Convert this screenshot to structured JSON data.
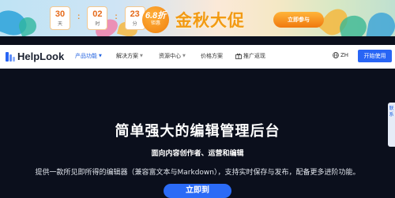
{
  "promo": {
    "countdown": [
      {
        "value": "30",
        "unit": "天"
      },
      {
        "value": "02",
        "unit": "时"
      },
      {
        "value": "23",
        "unit": "分"
      }
    ],
    "separator": ":",
    "discount": {
      "value": "6.8折",
      "suffix": "钜惠"
    },
    "title": "金秋大促",
    "cta": "立即参与",
    "colors": {
      "accent": "#f29a14",
      "button": "#f0780e"
    }
  },
  "nav": {
    "logo": "HelpLook",
    "items": [
      {
        "label": "产品功能",
        "active": true,
        "chevron": true
      },
      {
        "label": "解决方案",
        "active": false,
        "chevron": true
      },
      {
        "label": "资源中心",
        "active": false,
        "chevron": true
      },
      {
        "label": "价格方案",
        "active": false,
        "chevron": false
      },
      {
        "label": "推广返现",
        "active": false,
        "chevron": false,
        "icon": "gift-icon"
      }
    ],
    "lang": "ZH",
    "cta": "开始使用",
    "colors": {
      "primary": "#2865f5"
    }
  },
  "hero": {
    "title": "简单强大的编辑管理后台",
    "subtitle": "面向内容创作者、运营和编辑",
    "description": "提供一款所见即所得的编辑器（兼容富文本与Markdown），支持实时保存与发布，配备更多进阶功能。",
    "button": "立即到",
    "side_tab": "联系"
  }
}
